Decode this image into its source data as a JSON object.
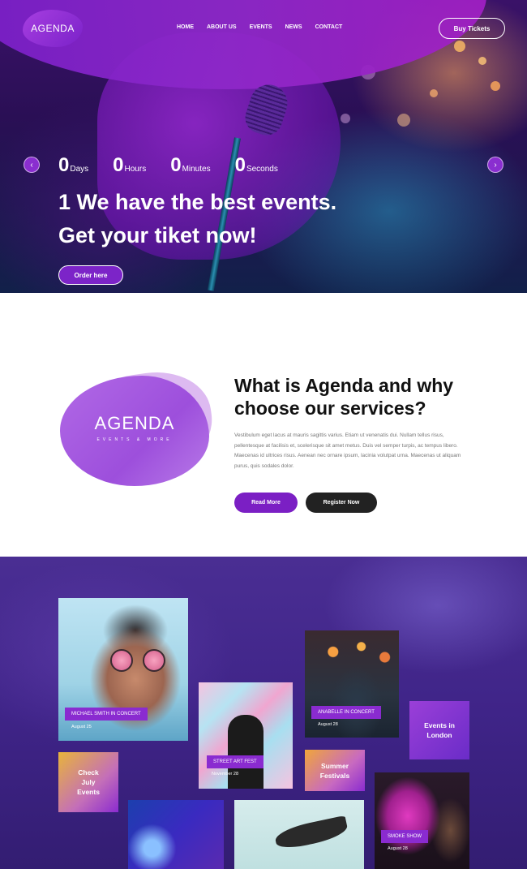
{
  "brand": {
    "logo_text": "AGENDA"
  },
  "nav": {
    "items": [
      "HOME",
      "ABOUT US",
      "EVENTS",
      "NEWS",
      "CONTACT"
    ],
    "buy_label": "Buy Tickets"
  },
  "hero": {
    "countdown": [
      {
        "value": "0",
        "unit": "Days"
      },
      {
        "value": "0",
        "unit": "Hours"
      },
      {
        "value": "0",
        "unit": "Minutes"
      },
      {
        "value": "0",
        "unit": "Seconds"
      }
    ],
    "headline_line1": "1 We have the best events.",
    "headline_line2": "Get your tiket now!",
    "cta_label": "Order here",
    "prev_arrow": "‹",
    "next_arrow": "›"
  },
  "about": {
    "logo_title": "AGENDA",
    "logo_subtitle": "EVENTS & MORE",
    "title": "What is Agenda and why choose our services?",
    "text": "Vestibulum eget lacus at mauris sagittis varius. Etiam ut venenatis dui. Nullam tellus risus, pellentesque at facilisis et, scelerisque sit amet metus. Duis vel semper turpis, ac tempus libero. Maecenas id ultrices risus. Aenean nec ornare ipsum, lacinia volutpat urna. Maecenas ut aliquam purus, quis sodales dolor.",
    "read_more_label": "Read More",
    "register_label": "Register Now"
  },
  "events": {
    "tiles": [
      {
        "label": "MICHAEL SMITH IN CONCERT",
        "date": "August 25"
      },
      {
        "label": "STREET ART FEST",
        "date": "November 28"
      },
      {
        "label": "ANABELLE IN CONCERT",
        "date": "August 28"
      },
      {
        "label": "SMOKE SHOW",
        "date": "August 28"
      }
    ],
    "text_tiles": {
      "events_london": "Events in London",
      "check_july": "Check July Events",
      "summer_festivals": "Summer Festivals"
    }
  },
  "colors": {
    "accent": "#7b1fc4",
    "dark_button": "#222222",
    "events_bg": "#3f2488"
  }
}
